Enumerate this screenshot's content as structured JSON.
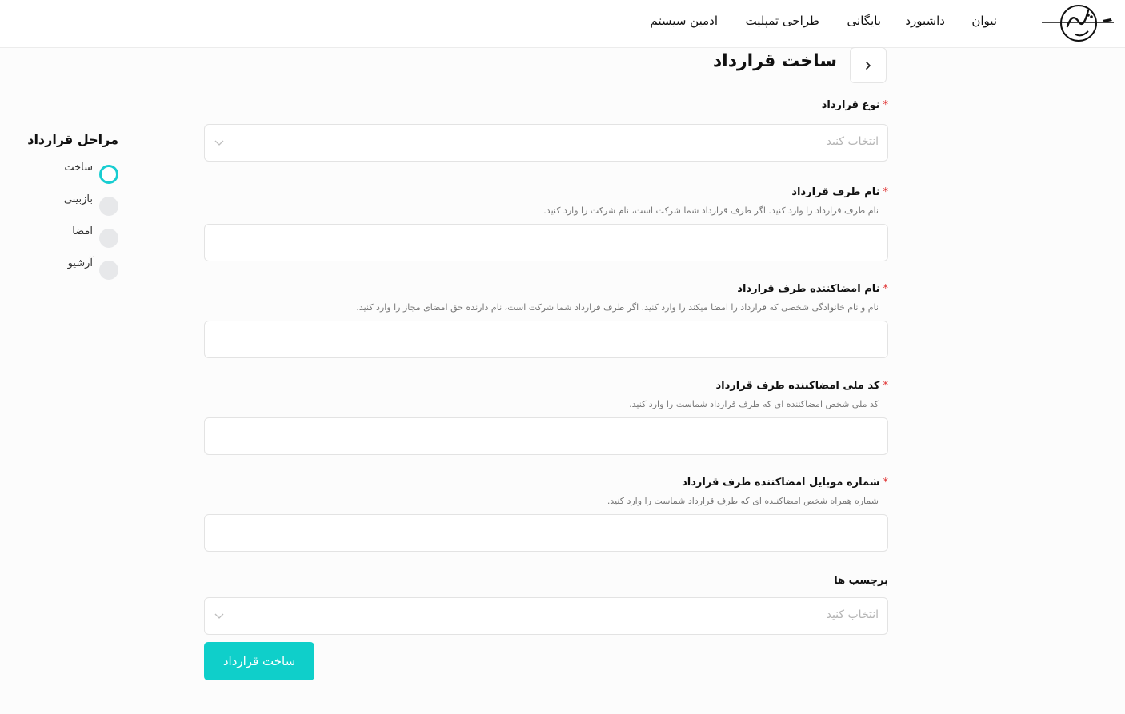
{
  "nav": {
    "items": [
      {
        "label": "نیوان"
      },
      {
        "label": "داشبورد"
      },
      {
        "label": "بایگانی"
      },
      {
        "label": "طراحی تمپلیت"
      },
      {
        "label": "ادمین سیستم"
      }
    ]
  },
  "page": {
    "title": "ساخت قرارداد",
    "back_icon": "chevron-right-icon"
  },
  "form": {
    "contract_type": {
      "label": "نوع قرارداد",
      "required": "*",
      "placeholder": "انتخاب کنید"
    },
    "party_name": {
      "label": "نام طرف قرارداد",
      "required": "*",
      "help": "نام طرف قرارداد را وارد کنید. اگر طرف قرارداد شما شرکت است، نام شرکت را وارد کنید.",
      "value": ""
    },
    "signer_name": {
      "label": "نام امضاکننده طرف قرارداد",
      "required": "*",
      "help": "نام و نام خانوادگی شخصی که قرارداد را امضا میکند را وارد کنید. اگر طرف قرارداد شما شرکت است، نام دارنده حق امضای مجاز را وارد کنید.",
      "value": ""
    },
    "signer_national_id": {
      "label": "کد ملی امضاکننده طرف قرارداد",
      "required": "*",
      "help": "کد ملی شخص امضاکننده ای که طرف قرارداد شماست را وارد کنید.",
      "value": ""
    },
    "signer_mobile": {
      "label": "شماره موبایل امضاکننده طرف قرارداد",
      "required": "*",
      "help": "شماره همراه شخص امضاکننده ای که طرف قرارداد شماست را وارد کنید.",
      "value": ""
    },
    "tags": {
      "label": "برچسب ها",
      "placeholder": "انتخاب کنید"
    },
    "submit_label": "ساخت قرارداد"
  },
  "steps": {
    "title": "مراحل قرارداد",
    "items": [
      {
        "label": "ساخت",
        "state": "active"
      },
      {
        "label": "بازبینی",
        "state": "pending"
      },
      {
        "label": "امضا",
        "state": "pending"
      },
      {
        "label": "آرشیو",
        "state": "pending"
      }
    ]
  },
  "colors": {
    "accent": "#0fcfca",
    "required": "#e03131",
    "step_active": "#18cdd1",
    "step_pending": "#e7e8ea"
  }
}
